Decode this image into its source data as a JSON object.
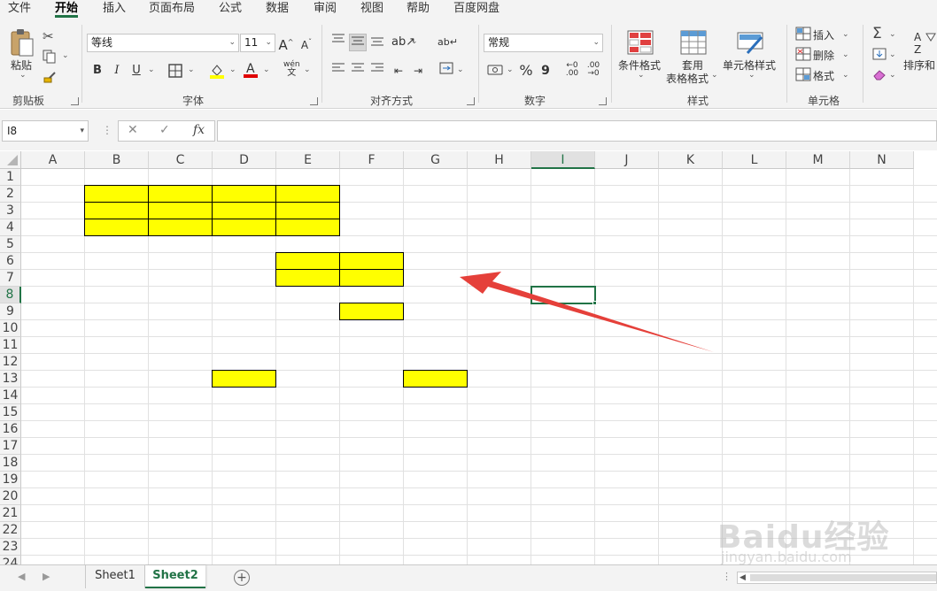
{
  "menu": {
    "tabs": [
      {
        "label": "文件",
        "active": false
      },
      {
        "label": "开始",
        "active": true
      },
      {
        "label": "插入",
        "active": false
      },
      {
        "label": "页面布局",
        "active": false
      },
      {
        "label": "公式",
        "active": false
      },
      {
        "label": "数据",
        "active": false
      },
      {
        "label": "审阅",
        "active": false
      },
      {
        "label": "视图",
        "active": false
      },
      {
        "label": "帮助",
        "active": false
      },
      {
        "label": "百度网盘",
        "active": false
      }
    ]
  },
  "ribbon": {
    "clipboard": {
      "paste_label": "粘贴",
      "group_label": "剪贴板"
    },
    "font": {
      "font_name": "等线",
      "font_size": "11",
      "grow_label": "A",
      "shrink_label": "A",
      "bold": "B",
      "italic": "I",
      "underline": "U",
      "phonetic_label": "wén",
      "phonetic_sub": "文",
      "group_label": "字体"
    },
    "alignment": {
      "group_label": "对齐方式"
    },
    "number": {
      "format": "常规",
      "percent": "%",
      "comma": "9",
      "group_label": "数字"
    },
    "styles": {
      "conditional_label": "条件格式",
      "table_label_1": "套用",
      "table_label_2": "表格格式",
      "cell_styles_label": "单元格样式",
      "group_label": "样式"
    },
    "cells": {
      "insert_label": "插入",
      "delete_label": "删除",
      "format_label": "格式",
      "group_label": "单元格"
    },
    "editing": {
      "sort_label": "排序和"
    }
  },
  "formula_bar": {
    "name_box": "I8",
    "cancel": "✕",
    "confirm": "✓",
    "fx": "fx",
    "value": ""
  },
  "grid": {
    "columns": [
      "A",
      "B",
      "C",
      "D",
      "E",
      "F",
      "G",
      "H",
      "I",
      "J",
      "K",
      "L",
      "M",
      "N"
    ],
    "rows": [
      "1",
      "2",
      "3",
      "4",
      "5",
      "6",
      "7",
      "8",
      "9",
      "10",
      "11",
      "12",
      "13",
      "14",
      "15",
      "16",
      "17",
      "18",
      "19",
      "20",
      "21",
      "22",
      "23",
      "24"
    ],
    "selected_cell": "I8",
    "selected_column": "I",
    "selected_row": "8",
    "highlight_color": "#FFFF00",
    "highlighted_cells": [
      "B2",
      "C2",
      "D2",
      "E2",
      "B3",
      "C3",
      "D3",
      "E3",
      "B4",
      "C4",
      "D4",
      "E4",
      "E6",
      "F6",
      "E7",
      "F7",
      "F9",
      "D13",
      "G13"
    ]
  },
  "annotation": {
    "arrow_color": "#E5403A"
  },
  "sheets": {
    "tabs": [
      {
        "label": "Sheet1",
        "active": false
      },
      {
        "label": "Sheet2",
        "active": true
      }
    ],
    "add_label": "+"
  },
  "watermark": {
    "brand": "Baidu经验",
    "url": "jingyan.baidu.com"
  },
  "accent_color": "#217346"
}
